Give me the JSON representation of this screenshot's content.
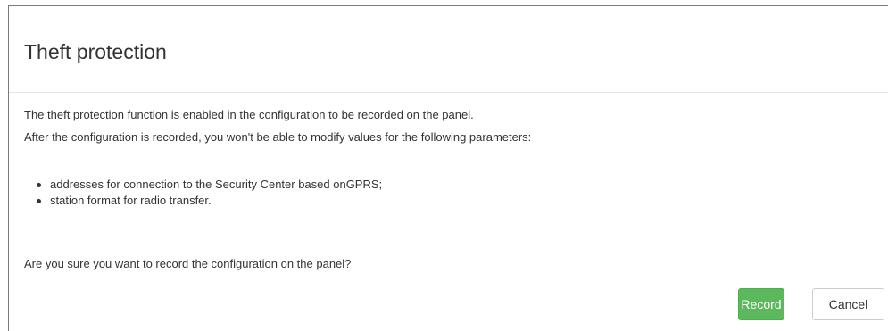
{
  "dialog": {
    "title": "Theft protection",
    "message_enabled": "The theft protection function is enabled in the configuration to be recorded on the panel.",
    "message_restriction": "After the configuration is recorded, you won't be able to modify values for the following parameters:",
    "parameters": [
      "addresses for connection to the Security Center based onGPRS;",
      "station format for radio transfer."
    ],
    "question": "Are you sure you want to record the configuration on the panel?",
    "buttons": {
      "record": "Record",
      "cancel": "Cancel"
    }
  },
  "colors": {
    "record_button": "#5cb85c",
    "cancel_button": "#ffffff",
    "text": "#333333",
    "divider": "#e5e5e5"
  }
}
